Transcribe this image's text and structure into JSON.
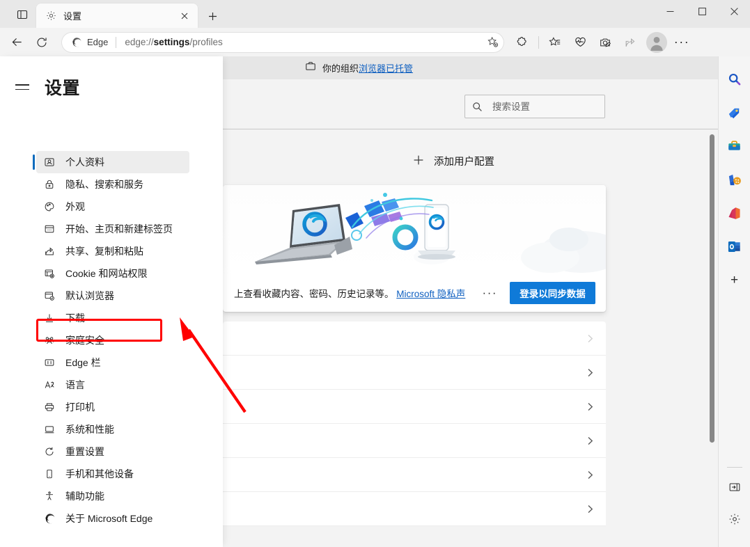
{
  "window": {
    "tab": {
      "title": "设置",
      "favicon_icon": "gear-icon",
      "close_icon": "close-icon"
    },
    "tabstrip_icon": "tab-actions-icon",
    "newtab_icon": "plus-icon",
    "controls": {
      "minimize": "minimize-icon",
      "maximize": "maximize-icon",
      "close": "close-icon"
    }
  },
  "toolbar": {
    "back_icon": "back-arrow-icon",
    "refresh_icon": "refresh-icon",
    "edge_badge_label": "Edge",
    "url_prefix": "edge://",
    "url_bold": "settings",
    "url_suffix": "/profiles",
    "url_full": "edge://settings/profiles",
    "favorite_add_icon": "star-plus-icon",
    "extensions_icon": "extensions-puzzle-icon",
    "collections_icon": "collections-star-icon",
    "browser_essentials_icon": "heartbeat-icon",
    "screenshot_icon": "web-capture-icon",
    "share_icon": "share-icon",
    "profile_icon": "account-avatar-icon",
    "settings_more_icon": "ellipsis-icon",
    "settings_more_label": "···"
  },
  "managed_banner": {
    "icon": "briefcase-icon",
    "text_plain": "你的组织",
    "text_link": "浏览器已托管"
  },
  "search": {
    "icon": "search-icon",
    "placeholder": "搜索设置",
    "value": ""
  },
  "settings_sidebar": {
    "hamburger_icon": "hamburger-menu-icon",
    "title": "设置",
    "items": [
      {
        "label": "个人资料",
        "icon": "profile-card-icon",
        "selected": true,
        "highlighted": false
      },
      {
        "label": "隐私、搜索和服务",
        "icon": "lock-icon",
        "selected": false,
        "highlighted": false
      },
      {
        "label": "外观",
        "icon": "palette-icon",
        "selected": false,
        "highlighted": false
      },
      {
        "label": "开始、主页和新建标签页",
        "icon": "newtab-page-icon",
        "selected": false,
        "highlighted": false
      },
      {
        "label": "共享、复制和粘贴",
        "icon": "share-box-icon",
        "selected": false,
        "highlighted": false
      },
      {
        "label": "Cookie 和网站权限",
        "icon": "cookie-permissions-icon",
        "selected": false,
        "highlighted": true
      },
      {
        "label": "默认浏览器",
        "icon": "default-browser-icon",
        "selected": false,
        "highlighted": false
      },
      {
        "label": "下载",
        "icon": "download-icon",
        "selected": false,
        "highlighted": false
      },
      {
        "label": "家庭安全",
        "icon": "family-safety-icon",
        "selected": false,
        "highlighted": false
      },
      {
        "label": "Edge 栏",
        "icon": "edge-bar-icon",
        "selected": false,
        "highlighted": false
      },
      {
        "label": "语言",
        "icon": "language-icon",
        "selected": false,
        "highlighted": false
      },
      {
        "label": "打印机",
        "icon": "printer-icon",
        "selected": false,
        "highlighted": false
      },
      {
        "label": "系统和性能",
        "icon": "system-performance-icon",
        "selected": false,
        "highlighted": false
      },
      {
        "label": "重置设置",
        "icon": "reset-icon",
        "selected": false,
        "highlighted": false
      },
      {
        "label": "手机和其他设备",
        "icon": "phone-icon",
        "selected": false,
        "highlighted": false
      },
      {
        "label": "辅助功能",
        "icon": "accessibility-icon",
        "selected": false,
        "highlighted": false
      },
      {
        "label": "关于 Microsoft Edge",
        "icon": "edge-logo-icon",
        "selected": false,
        "highlighted": false
      }
    ]
  },
  "main": {
    "add_profile": {
      "icon": "plus-icon",
      "label": "添加用户配置"
    },
    "profile_card": {
      "hero_image_alt": "laptop-and-phone-sync-illustration",
      "description_text": "上查看收藏内容、密码、历史记录等。",
      "privacy_link": "Microsoft 隐私声",
      "more_icon": "ellipsis-icon",
      "more_label": "···",
      "signin_button": "登录以同步数据"
    },
    "rows": [
      {
        "label": "",
        "chevron": "chevron-right-icon",
        "dim": true
      },
      {
        "label": "",
        "chevron": "chevron-right-icon",
        "dim": false
      },
      {
        "label": "",
        "chevron": "chevron-right-icon",
        "dim": false
      },
      {
        "label": "",
        "chevron": "chevron-right-icon",
        "dim": false
      },
      {
        "label": "",
        "chevron": "chevron-right-icon",
        "dim": false
      },
      {
        "label": "",
        "chevron": "chevron-right-icon",
        "dim": false
      }
    ]
  },
  "edge_bar": {
    "icons": [
      {
        "name": "bing-search-icon"
      },
      {
        "name": "shopping-tag-icon"
      },
      {
        "name": "tools-toolbox-icon"
      },
      {
        "name": "games-icon"
      },
      {
        "name": "office-icon"
      },
      {
        "name": "outlook-icon"
      }
    ],
    "add_icon": "plus-icon",
    "add_label": "+",
    "collapse_icon": "collapse-panel-icon",
    "settings_icon": "gear-icon"
  },
  "annotations": {
    "highlight_box_color": "#FF0000",
    "arrow_color": "#FF0000",
    "highlight_target": "Cookie 和网站权限"
  },
  "colors": {
    "accent_blue": "#0F7AD8",
    "link_blue": "#0E5FC0",
    "selection_bar": "#0F6CBD",
    "titlebar_bg": "#E8E8E8",
    "toolbar_bg": "#F3F3F3",
    "page_bg": "#F3F3F3",
    "card_bg": "#FFFFFF",
    "managed_bar_bg": "#E6E6E6"
  }
}
